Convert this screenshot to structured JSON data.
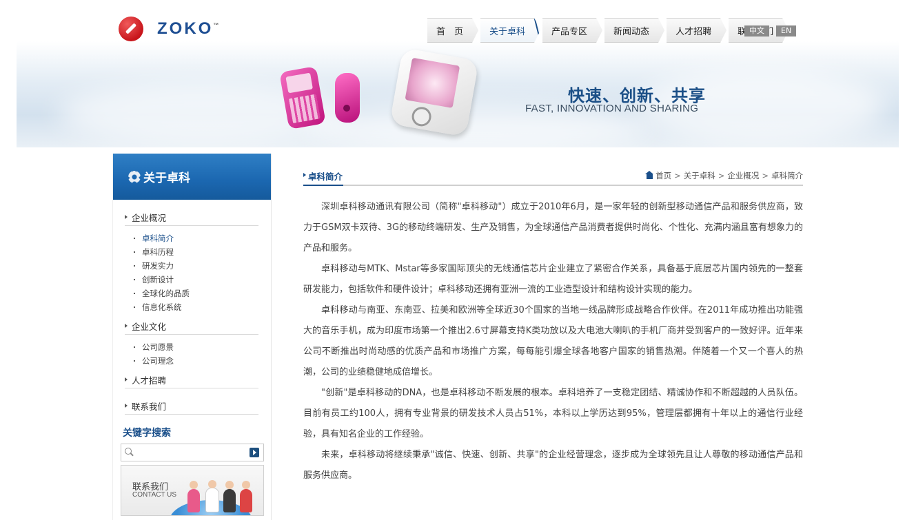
{
  "logo": {
    "text": "ZOKO",
    "tm": "™"
  },
  "nav": {
    "items": [
      {
        "label": "首　页"
      },
      {
        "label": "关于卓科"
      },
      {
        "label": "产品专区"
      },
      {
        "label": "新闻动态"
      },
      {
        "label": "人才招聘"
      },
      {
        "label": "联系我们"
      }
    ],
    "active_index": 1,
    "lang_cn": "中文",
    "lang_en": "EN"
  },
  "banner": {
    "slogan_cn": "快速、创新、共享",
    "slogan_en": "FAST, INNOVATION AND SHARING"
  },
  "sidebar": {
    "title": "关于卓科",
    "sections": [
      {
        "label": "企业概况",
        "items": [
          "卓科简介",
          "卓科历程",
          "研发实力",
          "创新设计",
          "全球化的品质",
          "信息化系统"
        ]
      },
      {
        "label": "企业文化",
        "items": [
          "公司愿景",
          "公司理念"
        ]
      },
      {
        "label": "人才招聘",
        "items": []
      },
      {
        "label": "联系我们",
        "items": []
      }
    ],
    "active_item": "卓科简介",
    "keyword_title": "关键字搜索",
    "search_placeholder": "",
    "contact_cn": "联系我们",
    "contact_en": "CONTACT US"
  },
  "main": {
    "title": "卓科简介",
    "breadcrumb": [
      "首页",
      "关于卓科",
      "企业概况",
      "卓科简介"
    ],
    "breadcrumb_sep": ">",
    "paragraphs": [
      "深圳卓科移动通讯有限公司（简称\"卓科移动\"）成立于2010年6月，是一家年轻的创新型移动通信产品和服务供应商，致力于GSM双卡双待、3G的移动终端研发、生产及销售，为全球通信产品消费者提供时尚化、个性化、充满内涵且富有想象力的产品和服务。",
      "卓科移动与MTK、Mstar等多家国际顶尖的无线通信芯片企业建立了紧密合作关系，具备基于底层芯片国内领先的一整套研发能力，包括软件和硬件设计；卓科移动还拥有亚洲一流的工业造型设计和结构设计实现的能力。",
      "卓科移动与南亚、东南亚、拉美和欧洲等全球近30个国家的当地一线品牌形成战略合作伙伴。在2011年成功推出功能强大的音乐手机，成为印度市场第一个推出2.6寸屏幕支持K类功放以及大电池大喇叭的手机厂商并受到客户的一致好评。近年来公司不断推出时尚动感的优质产品和市场推广方案，每每能引爆全球各地客户国家的销售热潮。伴随着一个又一个喜人的热潮，公司的业绩稳健地成倍增长。",
      "\"创新\"是卓科移动的DNA，也是卓科移动不断发展的根本。卓科培养了一支稳定团结、精诚协作和不断超越的人员队伍。目前有员工约100人，拥有专业背景的研发技术人员占51%，本科以上学历达到95%，管理层都拥有十年以上的通信行业经验，具有知名企业的工作经验。",
      "未来，卓科移动将继续秉承\"诚信、快速、创新、共享\"的企业经营理念，逐步成为全球领先且让人尊敬的移动通信产品和服务供应商。"
    ]
  },
  "colors": {
    "brand_blue": "#1a4f8a",
    "sidebar_header": "#1b67b0",
    "logo_red": "#c8151b"
  }
}
